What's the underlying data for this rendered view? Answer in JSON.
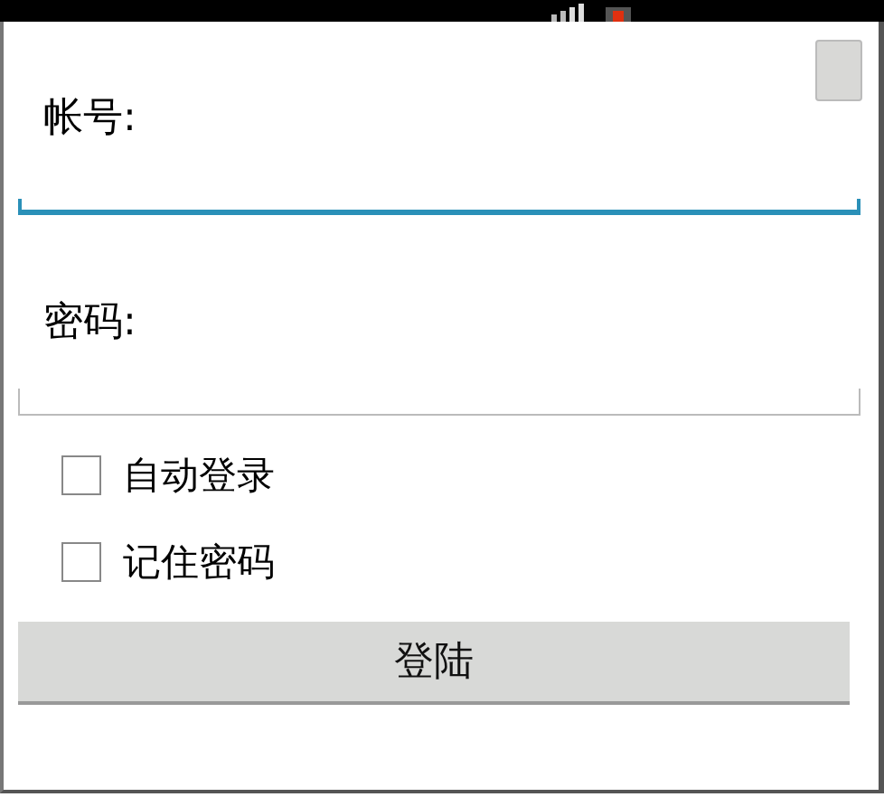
{
  "corner_button": {
    "kind": "button"
  },
  "fields": [
    {
      "label": "帐号:",
      "focused": true
    },
    {
      "label": "密码:",
      "focused": false
    }
  ],
  "checkboxes": [
    {
      "label": "自动登录",
      "checked": false
    },
    {
      "label": "记住密码",
      "checked": false
    }
  ],
  "login_button": {
    "label": "登陆"
  }
}
